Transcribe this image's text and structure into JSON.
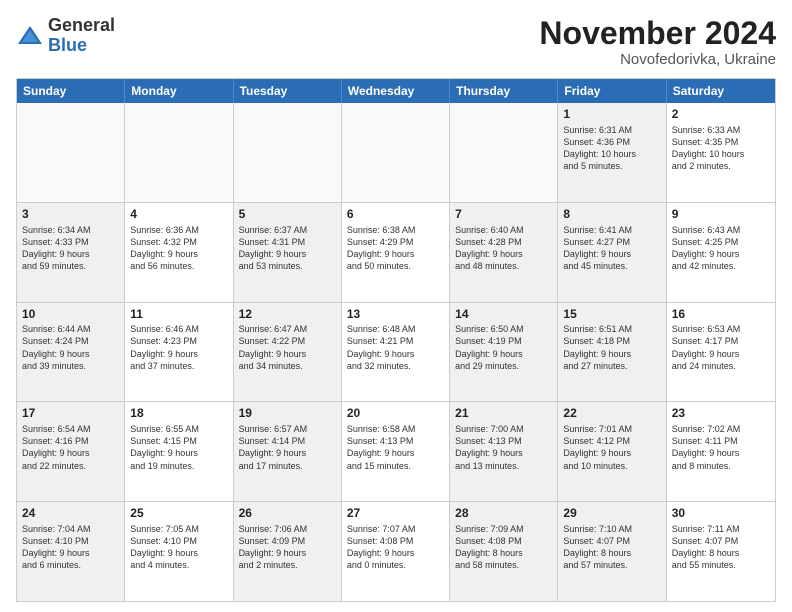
{
  "logo": {
    "general": "General",
    "blue": "Blue"
  },
  "header": {
    "month_year": "November 2024",
    "location": "Novofedorivka, Ukraine"
  },
  "weekdays": [
    "Sunday",
    "Monday",
    "Tuesday",
    "Wednesday",
    "Thursday",
    "Friday",
    "Saturday"
  ],
  "weeks": [
    [
      {
        "day": "",
        "info": "",
        "empty": true
      },
      {
        "day": "",
        "info": "",
        "empty": true
      },
      {
        "day": "",
        "info": "",
        "empty": true
      },
      {
        "day": "",
        "info": "",
        "empty": true
      },
      {
        "day": "",
        "info": "",
        "empty": true
      },
      {
        "day": "1",
        "info": "Sunrise: 6:31 AM\nSunset: 4:36 PM\nDaylight: 10 hours\nand 5 minutes.",
        "shaded": true
      },
      {
        "day": "2",
        "info": "Sunrise: 6:33 AM\nSunset: 4:35 PM\nDaylight: 10 hours\nand 2 minutes."
      }
    ],
    [
      {
        "day": "3",
        "info": "Sunrise: 6:34 AM\nSunset: 4:33 PM\nDaylight: 9 hours\nand 59 minutes.",
        "shaded": true
      },
      {
        "day": "4",
        "info": "Sunrise: 6:36 AM\nSunset: 4:32 PM\nDaylight: 9 hours\nand 56 minutes."
      },
      {
        "day": "5",
        "info": "Sunrise: 6:37 AM\nSunset: 4:31 PM\nDaylight: 9 hours\nand 53 minutes.",
        "shaded": true
      },
      {
        "day": "6",
        "info": "Sunrise: 6:38 AM\nSunset: 4:29 PM\nDaylight: 9 hours\nand 50 minutes."
      },
      {
        "day": "7",
        "info": "Sunrise: 6:40 AM\nSunset: 4:28 PM\nDaylight: 9 hours\nand 48 minutes.",
        "shaded": true
      },
      {
        "day": "8",
        "info": "Sunrise: 6:41 AM\nSunset: 4:27 PM\nDaylight: 9 hours\nand 45 minutes.",
        "shaded": true
      },
      {
        "day": "9",
        "info": "Sunrise: 6:43 AM\nSunset: 4:25 PM\nDaylight: 9 hours\nand 42 minutes."
      }
    ],
    [
      {
        "day": "10",
        "info": "Sunrise: 6:44 AM\nSunset: 4:24 PM\nDaylight: 9 hours\nand 39 minutes.",
        "shaded": true
      },
      {
        "day": "11",
        "info": "Sunrise: 6:46 AM\nSunset: 4:23 PM\nDaylight: 9 hours\nand 37 minutes."
      },
      {
        "day": "12",
        "info": "Sunrise: 6:47 AM\nSunset: 4:22 PM\nDaylight: 9 hours\nand 34 minutes.",
        "shaded": true
      },
      {
        "day": "13",
        "info": "Sunrise: 6:48 AM\nSunset: 4:21 PM\nDaylight: 9 hours\nand 32 minutes."
      },
      {
        "day": "14",
        "info": "Sunrise: 6:50 AM\nSunset: 4:19 PM\nDaylight: 9 hours\nand 29 minutes.",
        "shaded": true
      },
      {
        "day": "15",
        "info": "Sunrise: 6:51 AM\nSunset: 4:18 PM\nDaylight: 9 hours\nand 27 minutes.",
        "shaded": true
      },
      {
        "day": "16",
        "info": "Sunrise: 6:53 AM\nSunset: 4:17 PM\nDaylight: 9 hours\nand 24 minutes."
      }
    ],
    [
      {
        "day": "17",
        "info": "Sunrise: 6:54 AM\nSunset: 4:16 PM\nDaylight: 9 hours\nand 22 minutes.",
        "shaded": true
      },
      {
        "day": "18",
        "info": "Sunrise: 6:55 AM\nSunset: 4:15 PM\nDaylight: 9 hours\nand 19 minutes."
      },
      {
        "day": "19",
        "info": "Sunrise: 6:57 AM\nSunset: 4:14 PM\nDaylight: 9 hours\nand 17 minutes.",
        "shaded": true
      },
      {
        "day": "20",
        "info": "Sunrise: 6:58 AM\nSunset: 4:13 PM\nDaylight: 9 hours\nand 15 minutes."
      },
      {
        "day": "21",
        "info": "Sunrise: 7:00 AM\nSunset: 4:13 PM\nDaylight: 9 hours\nand 13 minutes.",
        "shaded": true
      },
      {
        "day": "22",
        "info": "Sunrise: 7:01 AM\nSunset: 4:12 PM\nDaylight: 9 hours\nand 10 minutes.",
        "shaded": true
      },
      {
        "day": "23",
        "info": "Sunrise: 7:02 AM\nSunset: 4:11 PM\nDaylight: 9 hours\nand 8 minutes."
      }
    ],
    [
      {
        "day": "24",
        "info": "Sunrise: 7:04 AM\nSunset: 4:10 PM\nDaylight: 9 hours\nand 6 minutes.",
        "shaded": true
      },
      {
        "day": "25",
        "info": "Sunrise: 7:05 AM\nSunset: 4:10 PM\nDaylight: 9 hours\nand 4 minutes."
      },
      {
        "day": "26",
        "info": "Sunrise: 7:06 AM\nSunset: 4:09 PM\nDaylight: 9 hours\nand 2 minutes.",
        "shaded": true
      },
      {
        "day": "27",
        "info": "Sunrise: 7:07 AM\nSunset: 4:08 PM\nDaylight: 9 hours\nand 0 minutes."
      },
      {
        "day": "28",
        "info": "Sunrise: 7:09 AM\nSunset: 4:08 PM\nDaylight: 8 hours\nand 58 minutes.",
        "shaded": true
      },
      {
        "day": "29",
        "info": "Sunrise: 7:10 AM\nSunset: 4:07 PM\nDaylight: 8 hours\nand 57 minutes.",
        "shaded": true
      },
      {
        "day": "30",
        "info": "Sunrise: 7:11 AM\nSunset: 4:07 PM\nDaylight: 8 hours\nand 55 minutes."
      }
    ]
  ]
}
